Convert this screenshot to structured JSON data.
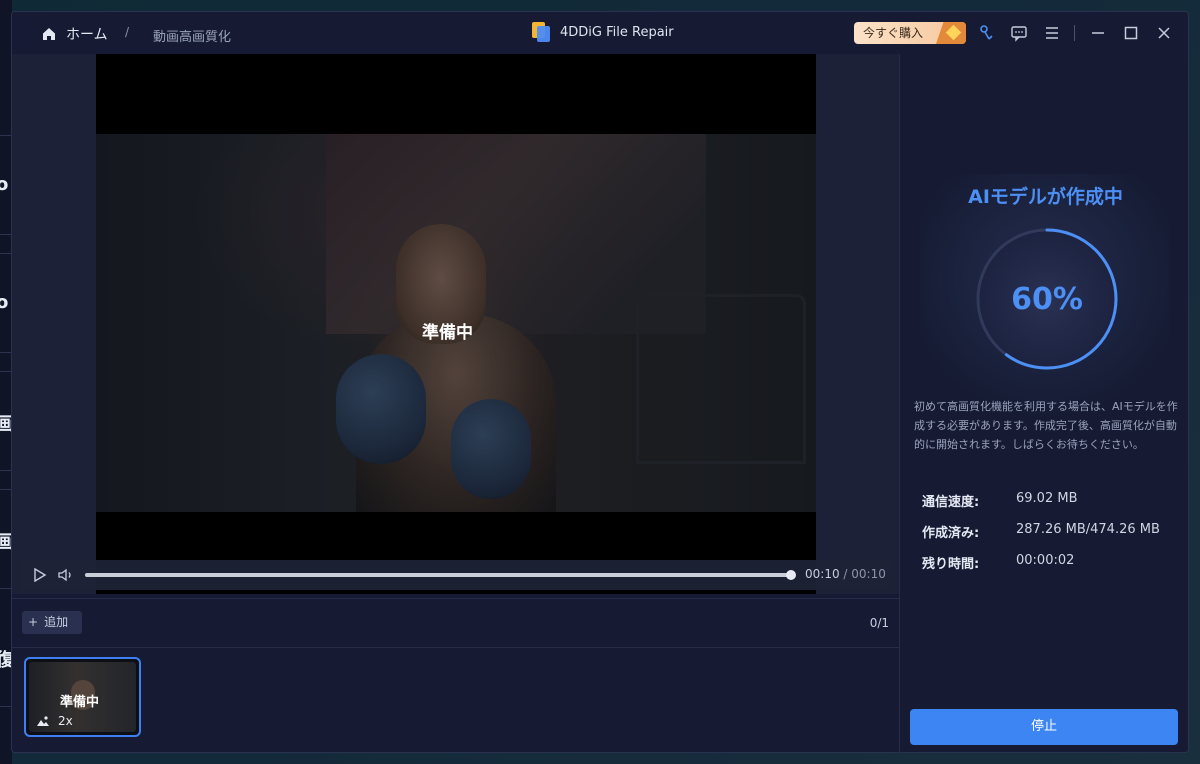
{
  "background": {
    "glyphs": [
      "o",
      "o",
      "画",
      "画",
      "復"
    ]
  },
  "titlebar": {
    "home_label": "ホーム",
    "separator": "/",
    "breadcrumb": "動画高画質化",
    "app_title": "4DDiG File Repair",
    "buy_label": "今すぐ購入",
    "icons": [
      "support-icon",
      "feedback-icon",
      "menu-icon",
      "minimize-icon",
      "maximize-icon",
      "close-icon"
    ]
  },
  "player": {
    "overlay_status": "準備中",
    "current_time": "00:10",
    "time_separator": " / ",
    "total_time": "00:10",
    "progress": 1.0
  },
  "list": {
    "add_label": "追加",
    "count": "0/1",
    "items": [
      {
        "status": "準備中",
        "scale": "2x",
        "selected": true
      }
    ]
  },
  "side": {
    "title": "AIモデルが作成中",
    "percent_label": "60%",
    "percent": 60,
    "description": "初めて高画質化機能を利用する場合は、AIモデルを作成する必要があります。作成完了後、高画質化が自動的に開始されます。しばらくお待ちください。",
    "stats": [
      {
        "key": "通信速度:",
        "value": "69.02 MB"
      },
      {
        "key": "作成済み:",
        "value": "287.26 MB/474.26 MB"
      },
      {
        "key": "残り時間:",
        "value": "00:00:02"
      }
    ],
    "stop_label": "停止"
  },
  "colors": {
    "accent": "#4c8ff5",
    "window_bg": "#161b33",
    "button_blue": "#3d85f2",
    "buy_gradient_start": "#fbe2c8"
  }
}
